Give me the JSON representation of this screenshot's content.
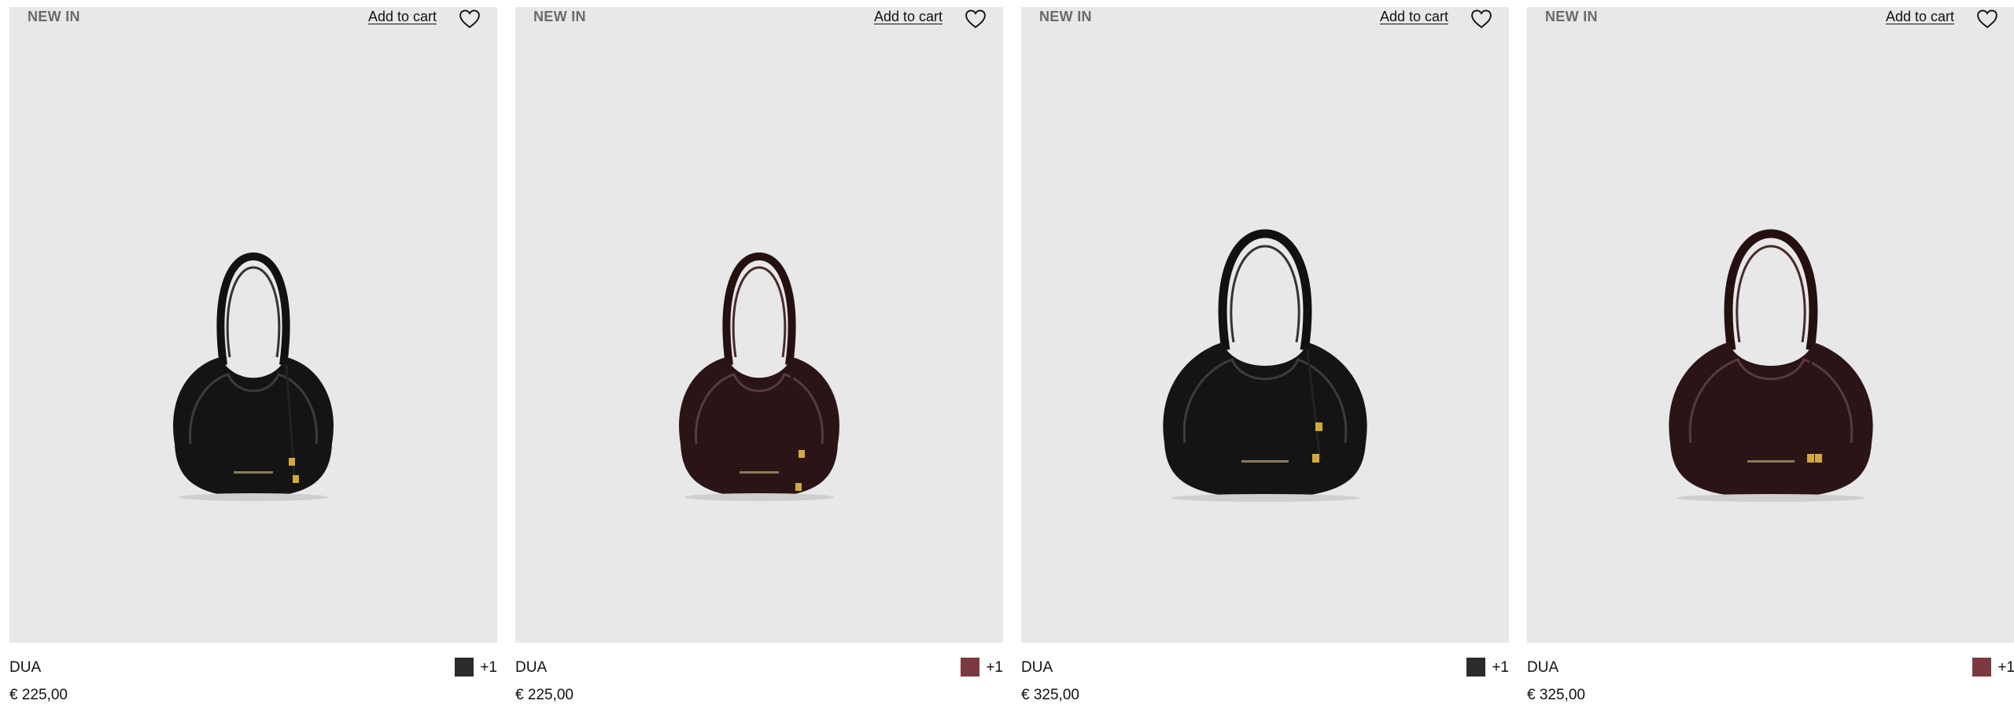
{
  "products": [
    {
      "badge": "NEW IN",
      "add_to_cart": "Add to cart",
      "wishlist_icon": "heart-icon",
      "name": "DUA",
      "price": "€ 225,00",
      "swatch_color": "#2b2b2b",
      "more_colors": "+1",
      "bag_color": "#1a1a1a",
      "bag_highlight": "#4a4a4a",
      "size": "small"
    },
    {
      "badge": "NEW IN",
      "add_to_cart": "Add to cart",
      "wishlist_icon": "heart-icon",
      "name": "DUA",
      "price": "€ 225,00",
      "swatch_color": "#7a3a40",
      "more_colors": "+1",
      "bag_color": "#2a1416",
      "bag_highlight": "#5a3a3c",
      "size": "small"
    },
    {
      "badge": "NEW IN",
      "add_to_cart": "Add to cart",
      "wishlist_icon": "heart-icon",
      "name": "DUA",
      "price": "€ 325,00",
      "swatch_color": "#2b2b2b",
      "more_colors": "+1",
      "bag_color": "#1a1a1a",
      "bag_highlight": "#4a4a4a",
      "size": "large"
    },
    {
      "badge": "NEW IN",
      "add_to_cart": "Add to cart",
      "wishlist_icon": "heart-icon",
      "name": "DUA",
      "price": "€ 325,00",
      "swatch_color": "#7a3a40",
      "more_colors": "+1",
      "bag_color": "#2a1416",
      "bag_highlight": "#5a3a3c",
      "size": "large"
    }
  ]
}
